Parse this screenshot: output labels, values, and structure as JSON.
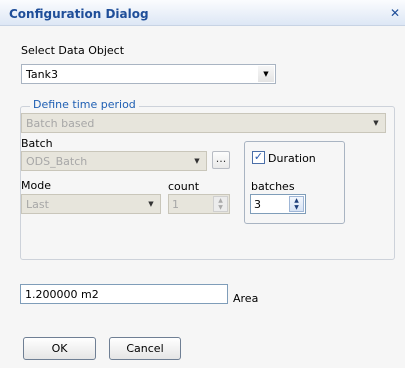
{
  "window": {
    "title": "Configuration Dialog",
    "close_glyph": "✕"
  },
  "data_object": {
    "label": "Select Data Object",
    "selected": "Tank3"
  },
  "time_period": {
    "legend": "Define time period",
    "type_selected": "Batch based",
    "batch_label": "Batch",
    "batch_selected": "ODS_Batch",
    "browse_label": "...",
    "duration_label": "Duration",
    "duration_checked": true,
    "mode_label": "Mode",
    "mode_selected": "Last",
    "count_label": "count",
    "count_value": "1",
    "batches_label": "batches",
    "batches_value": "3"
  },
  "area": {
    "value": "1.200000 m2",
    "label": "Area"
  },
  "buttons": {
    "ok": "OK",
    "cancel": "Cancel"
  },
  "colors": {
    "title": "#1f4e99",
    "legend": "#1f5fb3"
  }
}
